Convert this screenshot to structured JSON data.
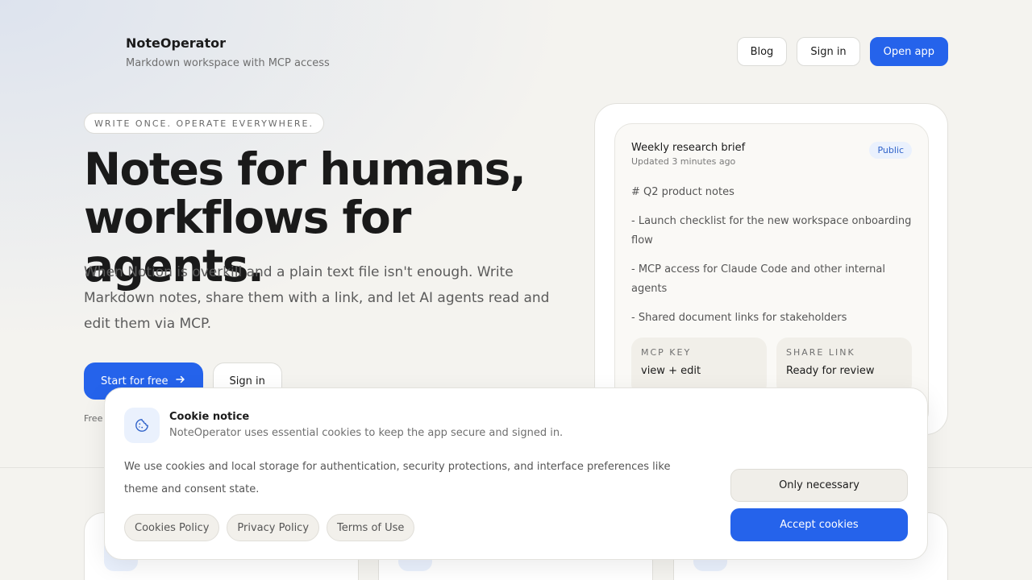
{
  "brand": {
    "name": "NoteOperator",
    "tagline": "Markdown workspace with MCP access"
  },
  "nav": {
    "blog": "Blog",
    "sign_in": "Sign in",
    "open_app": "Open app"
  },
  "hero": {
    "eyebrow": "WRITE ONCE. OPERATE EVERYWHERE.",
    "title_line1": "Notes for humans,",
    "title_line2": "workflows for agents.",
    "subtitle": "When Notion is overkill and a plain text file isn't enough. Write Markdown notes, share them with a link, and let AI agents read and edit them via MCP.",
    "cta_primary": "Start for free",
    "cta_secondary": "Sign in",
    "note": "Free"
  },
  "preview": {
    "title": "Weekly research brief",
    "updated": "Updated 3 minutes ago",
    "badge": "Public",
    "lines": [
      "# Q2 product notes",
      "- Launch checklist for the new workspace onboarding flow",
      "- MCP access for Claude Code and other internal agents",
      "- Shared document links for stakeholders"
    ],
    "tiles": [
      {
        "label": "MCP KEY",
        "value": "view + edit"
      },
      {
        "label": "SHARE LINK",
        "value": "Ready for review"
      }
    ]
  },
  "cookie": {
    "title": "Cookie notice",
    "subtitle": "NoteOperator uses essential cookies to keep the app secure and signed in.",
    "body": "We use cookies and local storage for authentication, security protections, and interface preferences like theme and consent state.",
    "links": [
      "Cookies Policy",
      "Privacy Policy",
      "Terms of Use"
    ],
    "only_necessary": "Only necessary",
    "accept": "Accept cookies"
  },
  "colors": {
    "accent": "#2563eb",
    "background": "#f4f3ef",
    "badge_bg": "#eaf1fd"
  },
  "icons": [
    "arrow-right-icon",
    "cookie-icon"
  ]
}
